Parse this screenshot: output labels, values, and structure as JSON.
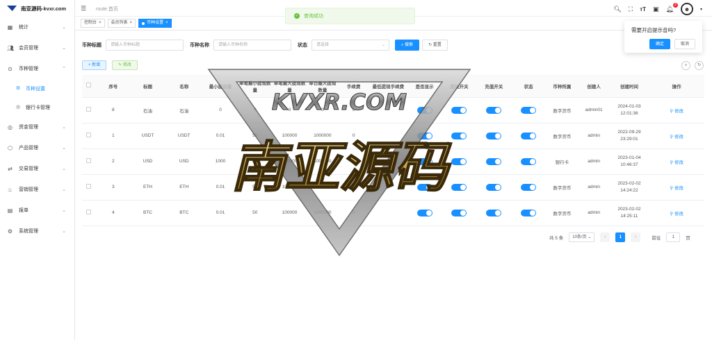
{
  "app": {
    "logo_text": "南亚源码-kvxr.com",
    "route": "route.首页"
  },
  "sidebar": {
    "items": [
      {
        "label": "统计",
        "icon": "chart-icon"
      },
      {
        "label": "会员管理",
        "icon": "users-icon"
      },
      {
        "label": "币种管理",
        "icon": "currency-icon",
        "expanded": true
      },
      {
        "label": "资金管理",
        "icon": "money-icon"
      },
      {
        "label": "产品管理",
        "icon": "product-icon"
      },
      {
        "label": "交易管理",
        "icon": "trade-icon"
      },
      {
        "label": "营销管理",
        "icon": "marketing-icon"
      },
      {
        "label": "报单",
        "icon": "report-icon"
      },
      {
        "label": "系统管理",
        "icon": "gear-icon"
      }
    ],
    "subitems": [
      {
        "label": "币种设置",
        "active": true
      },
      {
        "label": "银行卡管理",
        "active": false
      }
    ]
  },
  "tabs": [
    {
      "label": "控制台"
    },
    {
      "label": "会员列表"
    },
    {
      "label": "币种设置",
      "active": true
    }
  ],
  "toast": {
    "text": "查询成功"
  },
  "header": {
    "notification_count": "2"
  },
  "popup": {
    "question": "需要开启提示音吗?",
    "confirm": "确定",
    "cancel": "取消"
  },
  "filter": {
    "title_label": "币种标题",
    "title_placeholder": "请输入币种标题",
    "name_label": "币种名称",
    "name_placeholder": "请输入币种名称",
    "status_label": "状态",
    "status_placeholder": "请选择",
    "search": "搜索",
    "reset": "重置"
  },
  "toolbar": {
    "add": "+ 新增",
    "edit": "修改"
  },
  "table": {
    "headers": [
      "序号",
      "标题",
      "名称",
      "最小提现量",
      "单笔最小提现数量",
      "单笔最大提现数量",
      "单日最大提现数量",
      "手续费",
      "最低提现手续费",
      "是否显示",
      "提现开关",
      "充值开关",
      "状态",
      "币种所属",
      "创建人",
      "创建时间",
      "操作"
    ],
    "rows": [
      {
        "id": "8",
        "title": "石油",
        "name": "石油",
        "min": "0",
        "smin": "0",
        "smax": "0",
        "dmax": "0",
        "fee": "0",
        "creator_type": "数字货币",
        "creator": "admin01",
        "date": "2024-01-03",
        "time": "12:01:36"
      },
      {
        "id": "1",
        "title": "USDT",
        "name": "USDT",
        "min": "0.01",
        "smin": "50",
        "smax": "100000",
        "dmax": "1000000",
        "fee": "0",
        "creator_type": "数字货币",
        "creator": "admin",
        "date": "2022-09-29",
        "time": "23:29:01"
      },
      {
        "id": "2",
        "title": "USD",
        "name": "USD",
        "min": "1000",
        "smin": "50",
        "smax": "100000",
        "dmax": "1000000",
        "fee": "0",
        "creator_type": "银行卡",
        "creator": "admin",
        "date": "2023-01-04",
        "time": "10:46:37"
      },
      {
        "id": "3",
        "title": "ETH",
        "name": "ETH",
        "min": "0.01",
        "smin": "50",
        "smax": "100000",
        "dmax": "1000000",
        "fee": "0",
        "creator_type": "数字货币",
        "creator": "admin",
        "date": "2023-02-02",
        "time": "14:24:22"
      },
      {
        "id": "4",
        "title": "BTC",
        "name": "BTC",
        "min": "0.01",
        "smin": "50",
        "smax": "100000",
        "dmax": "1000000",
        "fee": "0",
        "creator_type": "数字货币",
        "creator": "admin",
        "date": "2023-02-02",
        "time": "14:25:11"
      }
    ],
    "edit_label": "修改"
  },
  "pager": {
    "total": "共 5 条",
    "size": "10条/页",
    "current": "1",
    "goto": "前往",
    "goto_val": "1",
    "page_unit": "页"
  },
  "watermark": {
    "site": "KVXR.COM",
    "name": "南亚源码"
  }
}
